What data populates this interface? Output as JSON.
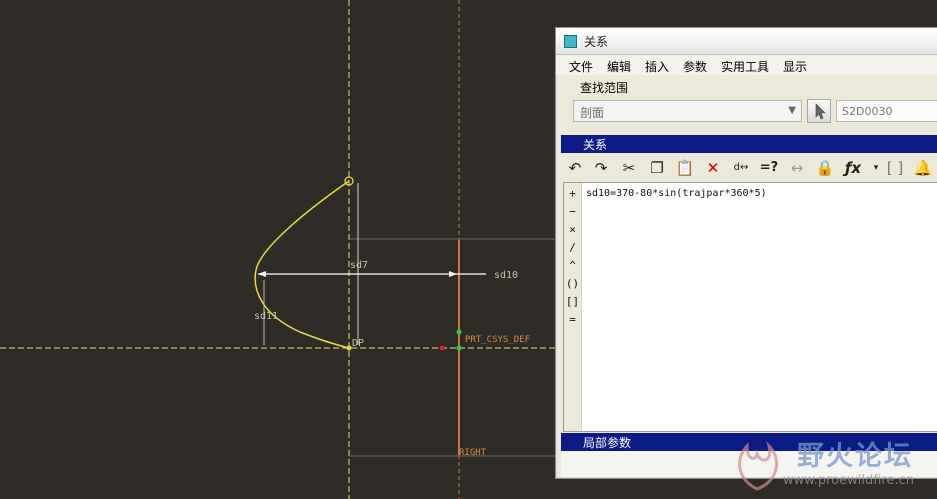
{
  "viewport": {
    "dim_labels": {
      "sd7": "sd7",
      "sd10": "sd10",
      "sd11": "sd11",
      "dp": "DP",
      "csys": "PRT_CSYS_DEF",
      "right": "RIGHT"
    }
  },
  "dialog": {
    "title": "关系",
    "menu": [
      "文件",
      "编辑",
      "插入",
      "参数",
      "实用工具",
      "显示"
    ],
    "scope_label": "查找范围",
    "scope_value": "剖面",
    "selected_id": "S2D0030",
    "relations_header": "关系",
    "toolbar_icons": [
      "undo-icon",
      "redo-icon",
      "cut-icon",
      "copy-icon",
      "paste-icon",
      "delete-icon",
      "switch-dims-icon",
      "evaluate-icon",
      "measure-icon",
      "lock-params-icon",
      "insert-function-icon",
      "insert-parameter-icon",
      "execute-icon"
    ],
    "operators": [
      "+",
      "−",
      "×",
      "/",
      "^",
      "()",
      "[]",
      "="
    ],
    "relation_text": "sd10=370-80*sin(trajpar*360*5)",
    "local_params_header": "局部参数"
  },
  "watermark": {
    "brand_cn": "野火论坛",
    "url": "www.proewildfire.cn"
  }
}
